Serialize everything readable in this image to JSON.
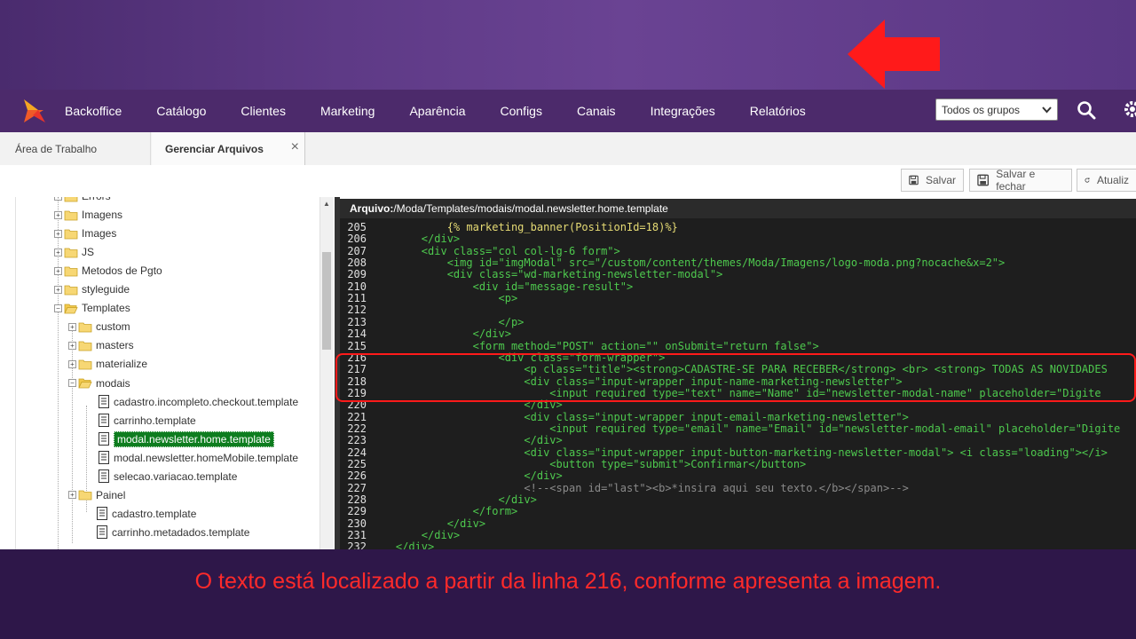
{
  "nav": {
    "items": [
      "Backoffice",
      "Catálogo",
      "Clientes",
      "Marketing",
      "Aparência",
      "Configs",
      "Canais",
      "Integrações",
      "Relatórios"
    ],
    "group_select": "Todos os grupos"
  },
  "tabs": [
    {
      "label": "Área de Trabalho"
    },
    {
      "label": "Gerenciar Arquivos",
      "close": "×"
    }
  ],
  "toolbar": {
    "save": "Salvar",
    "save_close": "Salvar e fechar",
    "refresh": "Atualiz"
  },
  "tree": [
    {
      "label": "Errors",
      "type": "folder"
    },
    {
      "label": "Imagens",
      "type": "folder"
    },
    {
      "label": "Images",
      "type": "folder"
    },
    {
      "label": "JS",
      "type": "folder"
    },
    {
      "label": "Metodos de Pgto",
      "type": "folder"
    },
    {
      "label": "styleguide",
      "type": "folder"
    },
    {
      "label": "Templates",
      "type": "folder-open"
    },
    {
      "label": "custom",
      "type": "folder"
    },
    {
      "label": "masters",
      "type": "folder"
    },
    {
      "label": "materialize",
      "type": "folder"
    },
    {
      "label": "modais",
      "type": "folder-open"
    },
    {
      "label": "cadastro.incompleto.checkout.template",
      "type": "file"
    },
    {
      "label": "carrinho.template",
      "type": "file"
    },
    {
      "label": "modal.newsletter.home.template",
      "type": "file",
      "selected": true
    },
    {
      "label": "modal.newsletter.homeMobile.template",
      "type": "file"
    },
    {
      "label": "selecao.variacao.template",
      "type": "file"
    },
    {
      "label": "Painel",
      "type": "folder"
    },
    {
      "label": "cadastro.template",
      "type": "file"
    },
    {
      "label": "carrinho.metadados.template",
      "type": "file"
    }
  ],
  "editor": {
    "header_label": "Arquivo:",
    "header_path": " /Moda/Templates/modais/modal.newsletter.home.template",
    "lines": [
      {
        "n": "205",
        "code": "            {% marketing_banner(PositionId=18)%}"
      },
      {
        "n": "206",
        "code": "        </div>"
      },
      {
        "n": "207",
        "code": "        <div class=\"col col-lg-6 form\">"
      },
      {
        "n": "208",
        "code": "            <img id=\"imgModal\" src=\"/custom/content/themes/Moda/Imagens/logo-moda.png?nocache&x=2\">"
      },
      {
        "n": "209",
        "code": "            <div class=\"wd-marketing-newsletter-modal\">"
      },
      {
        "n": "210",
        "code": "                <div id=\"message-result\">"
      },
      {
        "n": "211",
        "code": "                    <p>"
      },
      {
        "n": "212",
        "code": ""
      },
      {
        "n": "213",
        "code": "                    </p>"
      },
      {
        "n": "214",
        "code": "                </div>"
      },
      {
        "n": "215",
        "code": "                <form method=\"POST\" action=\"\" onSubmit=\"return false\">"
      },
      {
        "n": "216",
        "code": "                    <div class=\"form-wrapper\">"
      },
      {
        "n": "217",
        "code": "                        <p class=\"title\"><strong>CADASTRE-SE PARA RECEBER</strong> <br> <strong> TODAS AS NOVIDADES"
      },
      {
        "n": "218",
        "code": "                        <div class=\"input-wrapper input-name-marketing-newsletter\">"
      },
      {
        "n": "219",
        "code": "                            <input required type=\"text\" name=\"Name\" id=\"newsletter-modal-name\" placeholder=\"Digite"
      },
      {
        "n": "220",
        "code": "                        </div>"
      },
      {
        "n": "221",
        "code": "                        <div class=\"input-wrapper input-email-marketing-newsletter\">"
      },
      {
        "n": "222",
        "code": "                            <input required type=\"email\" name=\"Email\" id=\"newsletter-modal-email\" placeholder=\"Digite"
      },
      {
        "n": "223",
        "code": "                        </div>"
      },
      {
        "n": "224",
        "code": "                        <div class=\"input-wrapper input-button-marketing-newsletter-modal\"> <i class=\"loading\"></i>"
      },
      {
        "n": "225",
        "code": "                            <button type=\"submit\">Confirmar</button>"
      },
      {
        "n": "226",
        "code": "                        </div>"
      },
      {
        "n": "227",
        "code": "                        <!--<span id=\"last\"><b>*insira aqui seu texto.</b></span>-->"
      },
      {
        "n": "228",
        "code": "                    </div>"
      },
      {
        "n": "229",
        "code": "                </form>"
      },
      {
        "n": "230",
        "code": "            </div>"
      },
      {
        "n": "231",
        "code": "        </div>"
      },
      {
        "n": "232",
        "code": "    </div>"
      }
    ]
  },
  "caption": "O texto está localizado a partir da linha 216, conforme apresenta a imagem.",
  "colors": {
    "navbar": "#4c2a6b",
    "banner": "#5e3a86",
    "arrow": "#ff1a1a",
    "selected": "#0e7d1f",
    "caption": "#ff2a2a",
    "editor_bg": "#1e1e1e"
  }
}
